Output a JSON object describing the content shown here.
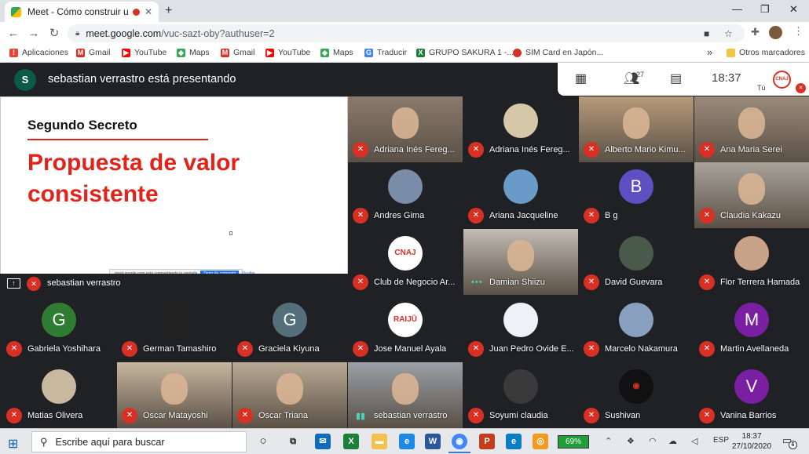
{
  "browser": {
    "tab_title": "Meet - Cómo construir un de",
    "tab_close": "✕",
    "new_tab": "+",
    "url_host": "meet.google.com",
    "url_path": "/vuc-sazt-oby?authuser=2",
    "window_min": "—",
    "window_restore": "❐",
    "window_close": "✕"
  },
  "bookmarks": [
    {
      "label": "Aplicaciones",
      "icon": "apps-grid-icon",
      "color": "#ea4335"
    },
    {
      "label": "Gmail",
      "icon": "gmail-icon",
      "color": "#d93025"
    },
    {
      "label": "YouTube",
      "icon": "youtube-icon",
      "color": "#ff0000"
    },
    {
      "label": "Maps",
      "icon": "maps-icon",
      "color": "#34a853"
    },
    {
      "label": "Gmail",
      "icon": "gmail-icon",
      "color": "#d93025"
    },
    {
      "label": "YouTube",
      "icon": "youtube-icon",
      "color": "#ff0000"
    },
    {
      "label": "Maps",
      "icon": "maps-icon",
      "color": "#34a853"
    },
    {
      "label": "Traducir",
      "icon": "translate-icon",
      "color": "#4285f4"
    },
    {
      "label": "GRUPO SAKURA 1 -...",
      "icon": "sheets-icon",
      "color": "#188038"
    },
    {
      "label": "SIM Card en Japón...",
      "icon": "red-circle-icon",
      "color": "#d93025"
    }
  ],
  "bookmarks_overflow": "»",
  "bookmarks_other": "Otros marcadores",
  "meet": {
    "presenter_initial": "S",
    "presenter_text": "sebastian verrastro está presentando",
    "participant_count": "27",
    "time": "18:37",
    "self_label": "Tú",
    "self_logo": "CNAJ"
  },
  "slide": {
    "heading": "Segundo Secreto",
    "title": "Propuesta de valor consistente",
    "share_notice": "meet.google.com está compartiendo tu pantalla",
    "stop_label": "Dejar de compartir",
    "hide_label": "Ocultar"
  },
  "presentation_footer": {
    "name": "sebastian verrastro"
  },
  "participants": [
    {
      "name": "Adriana Inés Fereg...",
      "kind": "photo",
      "bg": "#8a7a6c",
      "muted": true
    },
    {
      "name": "Adriana Inés Fereg...",
      "kind": "avatar-photo",
      "bg": "#202124",
      "av": "#d4c8a8",
      "muted": true
    },
    {
      "name": "Alberto Mario Kimu...",
      "kind": "photo",
      "bg": "#b79a7a",
      "muted": true
    },
    {
      "name": "Ana Maria Serei",
      "kind": "photo",
      "bg": "#9c8b7b",
      "muted": true
    },
    {
      "name": "Andres Gima",
      "kind": "avatar-photo",
      "bg": "#202124",
      "av": "#7a8da8",
      "muted": true
    },
    {
      "name": "Ariana Jacqueline",
      "kind": "avatar-photo",
      "bg": "#202124",
      "av": "#6a9ac8",
      "muted": true
    },
    {
      "name": "B g",
      "kind": "initial",
      "initial": "B",
      "bg": "#202124",
      "av": "#5e4fc2",
      "muted": true
    },
    {
      "name": "Claudia Kakazu",
      "kind": "photo",
      "bg": "#a9a39a",
      "muted": true
    },
    {
      "name": "Club de Negocio Ar...",
      "kind": "logo",
      "logo": "CNAJ",
      "bg": "#202124",
      "av": "#ffffff",
      "muted": true
    },
    {
      "name": "Damian Shiizu",
      "kind": "photo-speaking",
      "bg": "#c2bdb3",
      "muted": false
    },
    {
      "name": "David Guevara",
      "kind": "avatar-photo",
      "bg": "#202124",
      "av": "#4a5a4a",
      "muted": true
    },
    {
      "name": "Flor Terrera Hamada",
      "kind": "avatar-photo",
      "bg": "#202124",
      "av": "#c9a28a",
      "muted": true
    },
    {
      "name": "Gabriela Yoshihara",
      "kind": "initial",
      "initial": "G",
      "bg": "#202124",
      "av": "#2e7d32",
      "muted": true
    },
    {
      "name": "German Tamashiro",
      "kind": "avatar-photo",
      "bg": "#202124",
      "av": "#222222",
      "muted": true
    },
    {
      "name": "Graciela Kiyuna",
      "kind": "initial",
      "initial": "G",
      "bg": "#202124",
      "av": "#546e7a",
      "muted": true
    },
    {
      "name": "Jose Manuel Ayala",
      "kind": "logo",
      "logo": "RAIJŪ",
      "bg": "#202124",
      "av": "#ffffff",
      "muted": true
    },
    {
      "name": "Juan Pedro Ovide E...",
      "kind": "avatar-photo",
      "bg": "#202124",
      "av": "#eef2f6",
      "muted": true
    },
    {
      "name": "Marcelo Nakamura",
      "kind": "avatar-photo",
      "bg": "#202124",
      "av": "#8aa0c0",
      "muted": true
    },
    {
      "name": "Martin Avellaneda",
      "kind": "initial",
      "initial": "M",
      "bg": "#202124",
      "av": "#7b1fa2",
      "muted": true
    },
    {
      "name": "Matias Olivera",
      "kind": "avatar-photo",
      "bg": "#202124",
      "av": "#c8b8a0",
      "muted": true
    },
    {
      "name": "Oscar Matayoshi",
      "kind": "photo",
      "bg": "#c7b79f",
      "muted": true
    },
    {
      "name": "Oscar Triana",
      "kind": "photo",
      "bg": "#b9aa95",
      "muted": true
    },
    {
      "name": "sebastian verrastro",
      "kind": "photo-speaking",
      "bg": "#9aa0a6",
      "muted": false
    },
    {
      "name": "Soyumi claudia",
      "kind": "avatar-photo",
      "bg": "#202124",
      "av": "#3a3a3a",
      "muted": true
    },
    {
      "name": "Sushivan",
      "kind": "logo",
      "logo": "◉",
      "bg": "#202124",
      "av": "#111111",
      "muted": true
    },
    {
      "name": "Vanina Barrios",
      "kind": "initial",
      "initial": "V",
      "bg": "#202124",
      "av": "#7b1fa2",
      "muted": true
    }
  ],
  "taskbar": {
    "search_placeholder": "Escribe aquí para buscar",
    "battery": "69%",
    "lang": "ESP",
    "time": "18:37",
    "date": "27/10/2020",
    "notifications": "6"
  }
}
